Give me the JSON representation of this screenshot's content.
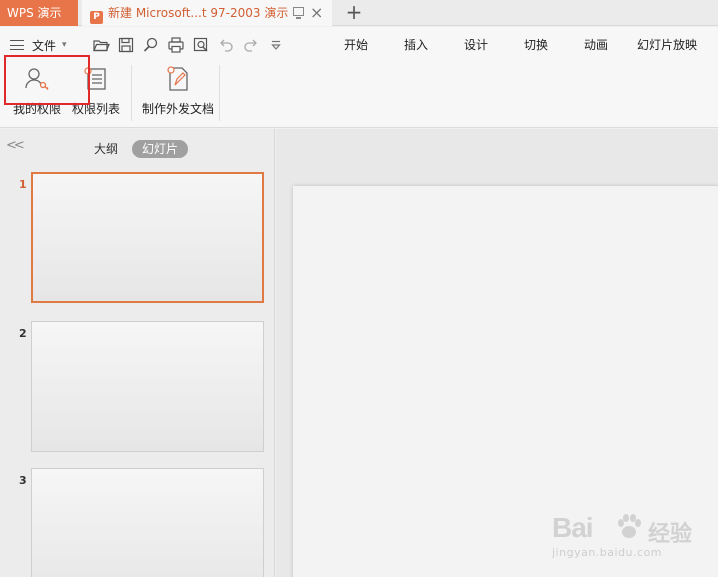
{
  "titlebar": {
    "app_tab": "WPS 演示",
    "doc_tab_icon": "P",
    "doc_tab_title": "新建 Microsoft...t 97-2003 演示",
    "close_glyph": "×",
    "new_tab_glyph": "+"
  },
  "ribbon": {
    "file_menu_label": "文件",
    "quick_tools": [
      "open-folder-icon",
      "save-icon",
      "find-icon",
      "print-icon",
      "print-preview-icon",
      "undo-icon",
      "redo-icon",
      "customize-dropdown-icon"
    ],
    "menu_tabs": [
      "开始",
      "插入",
      "设计",
      "切换",
      "动画",
      "幻灯片放映"
    ],
    "big_buttons": [
      {
        "label": "我的权限",
        "icon": "user-key-icon"
      },
      {
        "label": "权限列表",
        "icon": "permission-list-icon"
      },
      {
        "label": "制作外发文档",
        "icon": "create-outgoing-doc-icon"
      }
    ]
  },
  "leftpane": {
    "collapse_glyph": "<<",
    "tabs": [
      "大纲",
      "幻灯片"
    ],
    "active_tab": "幻灯片",
    "slides": [
      {
        "number": "1",
        "active": true
      },
      {
        "number": "2",
        "active": false
      },
      {
        "number": "3",
        "active": false
      }
    ]
  },
  "watermark": {
    "brand": "Bai",
    "cn": "经验",
    "url": "jingyan.baidu.com"
  },
  "colors": {
    "accent": "#e8754a",
    "highlight": "#e02a2a",
    "active_slide_border": "#e07a45"
  }
}
